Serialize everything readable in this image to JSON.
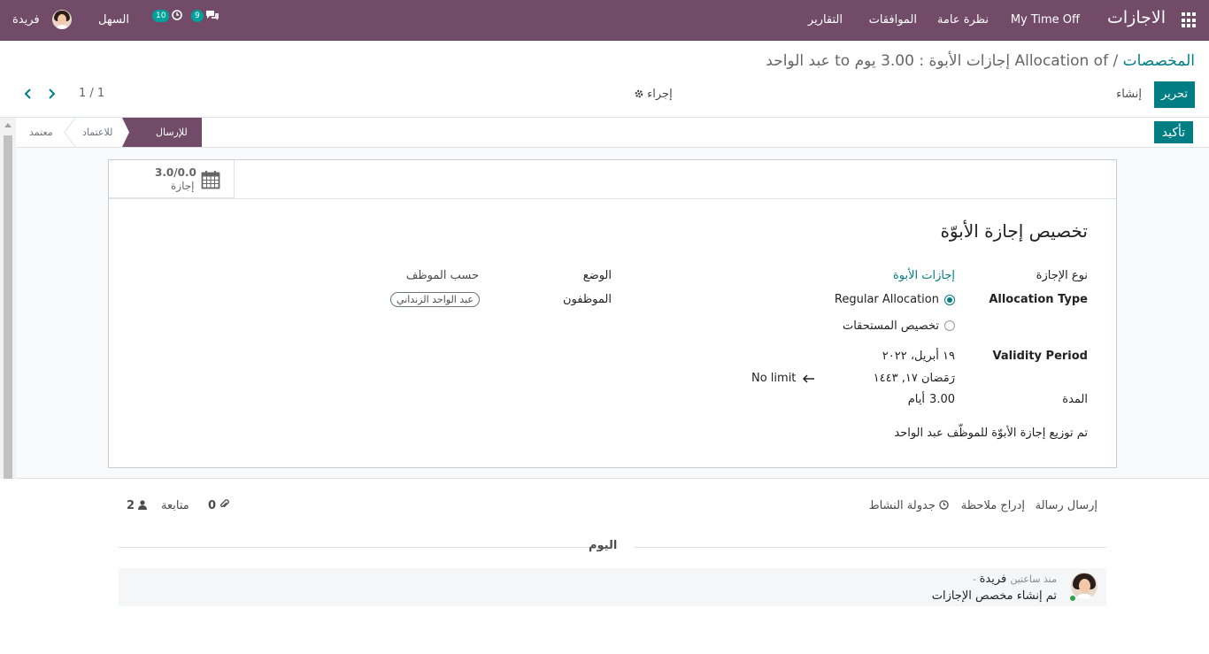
{
  "navbar": {
    "app_title": "الاجازات",
    "menu": [
      "My Time Off",
      "نظرة عامة",
      "الموافقات",
      "التقارير"
    ],
    "messages_badge": "9",
    "activities_badge": "10",
    "company": "السهل",
    "user": "فريدة"
  },
  "breadcrumb": {
    "parent": "المخصصات",
    "separator": " / ",
    "current": "Allocation of إجازات الأبوة : 3.00 يوم to عبد الواحد"
  },
  "actions": {
    "edit": "تحرير",
    "create": "إنشاء",
    "action": "إجراء",
    "confirm": "تأكيد",
    "pager": "1 / 1"
  },
  "statusbar": {
    "stages": [
      "للإرسال",
      "للاعتماد",
      "معتمد"
    ],
    "active": "للإرسال"
  },
  "smart_button": {
    "value": "3.0/0.0",
    "label": "إجازة"
  },
  "form": {
    "title": "تخصيص إجازة الأبوّة",
    "leave_type_label": "نوع الإجازة",
    "leave_type_value": "إجازات الأبوة",
    "allocation_type_label": "Allocation Type",
    "allocation_options": [
      "Regular Allocation",
      "تخصيص المستحقات"
    ],
    "allocation_selected": "Regular Allocation",
    "validity_label": "Validity Period",
    "validity_start": "١٩ أبريل، ٢٠٢٢",
    "validity_start_hijri": "رَمَضان ١٧, ١٤٤٣",
    "validity_end": "No limit",
    "duration_label": "المدة",
    "duration_value": "3.00",
    "duration_unit": "أيام",
    "mode_label": "الوضع",
    "mode_value": "حسب الموظف",
    "employees_label": "الموظفون",
    "employee_tag": "عبد الواحد الزنداني",
    "description": "تم توزيع إجازة الأبوّة للموظّف عبد الواحد"
  },
  "chatter": {
    "send_message": "إرسال رسالة",
    "log_note": "إدراج ملاحظة",
    "schedule_activity": "جدولة النشاط",
    "attachments_count": "0",
    "follow": "متابعة",
    "followers_count": "2",
    "today": "اليوم",
    "message": {
      "author": "فريدة",
      "time": "- منذ ساعتين",
      "body": "تم إنشاء مخصص الإجازات"
    }
  }
}
